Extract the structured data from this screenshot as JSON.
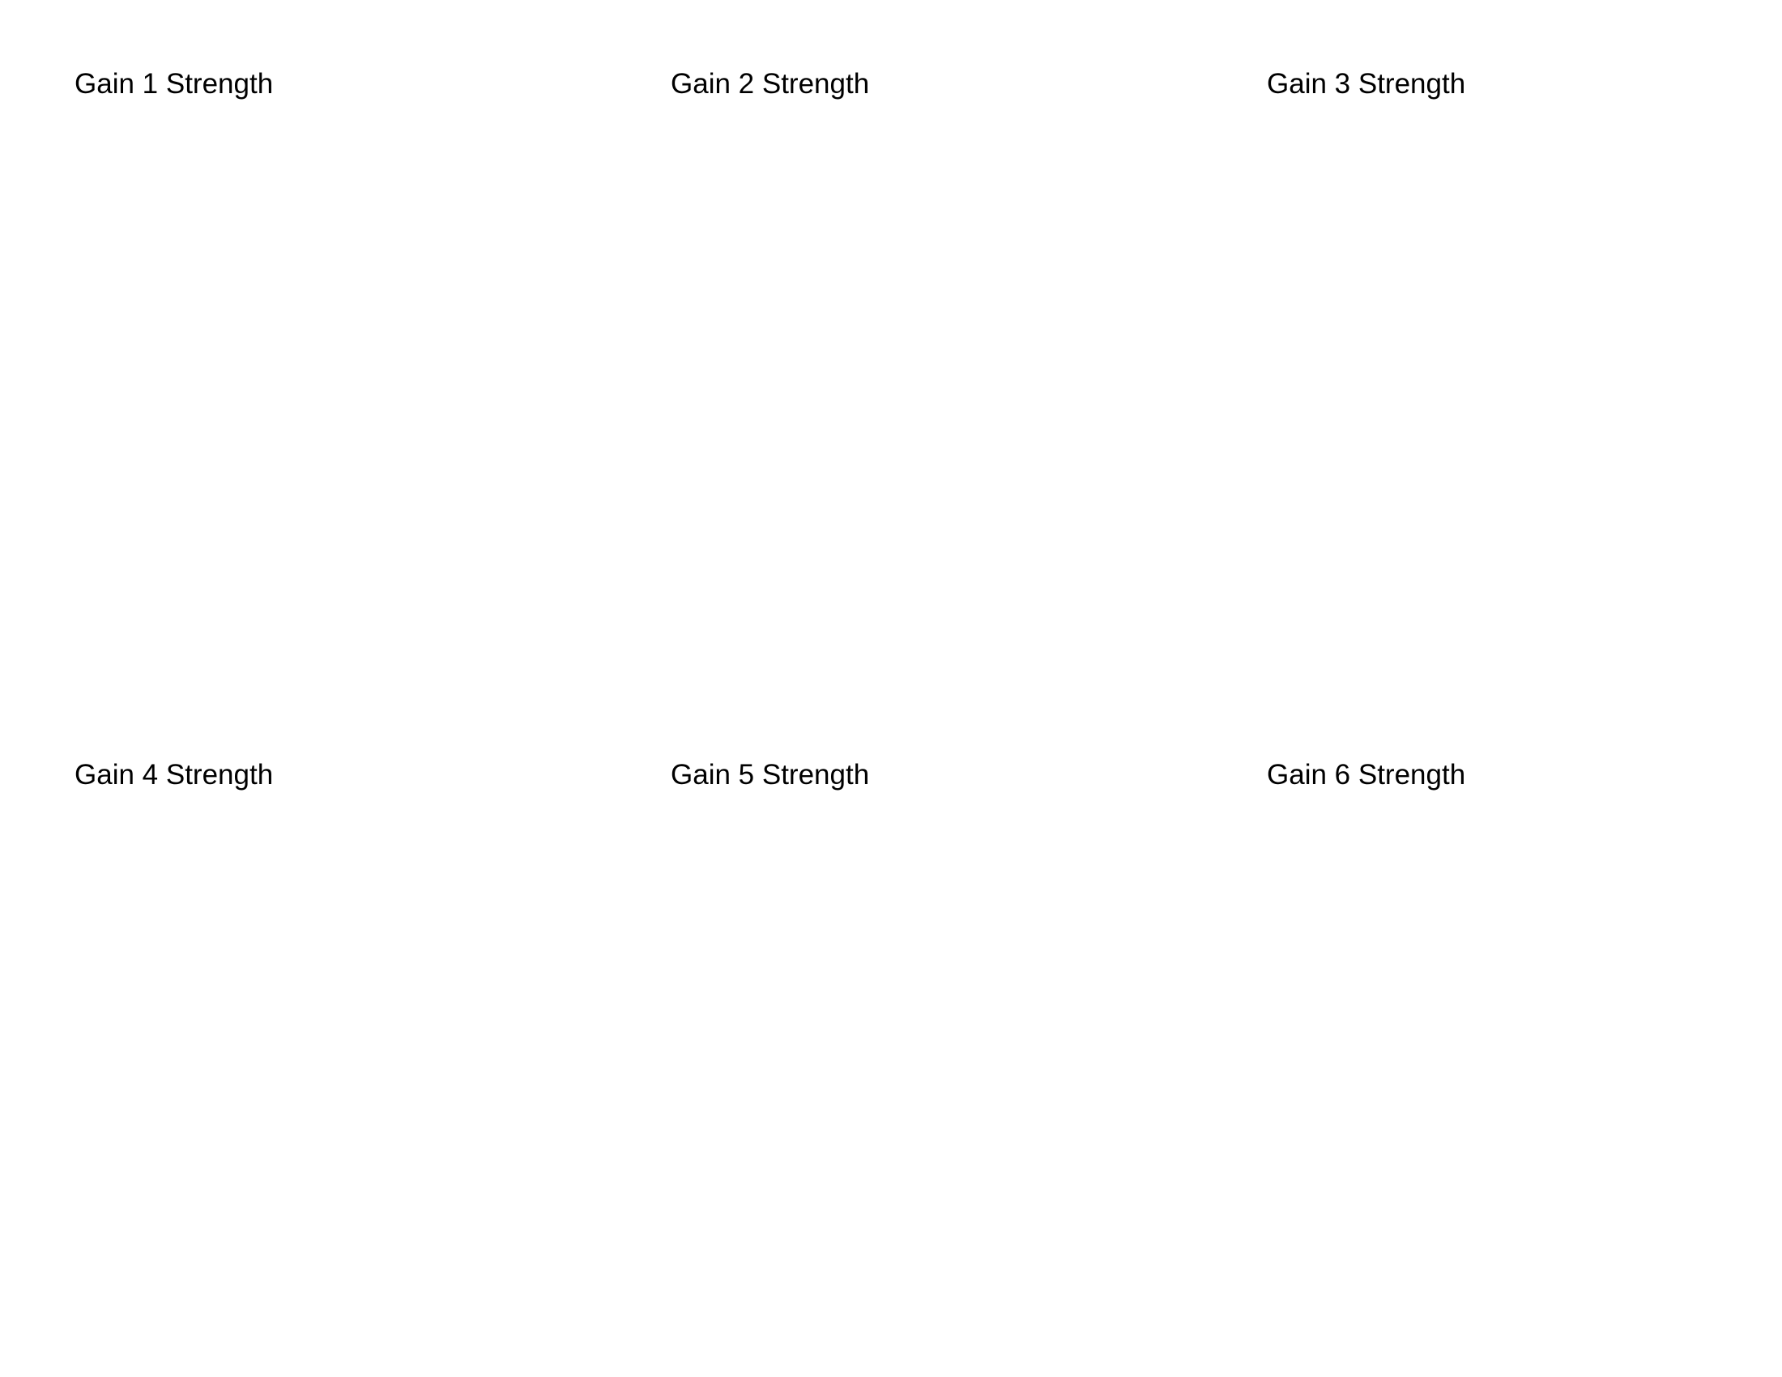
{
  "chart_data": [
    {
      "type": "bar",
      "title": "Gain 1 Strength",
      "categories": [],
      "values": []
    },
    {
      "type": "bar",
      "title": "Gain 2 Strength",
      "categories": [],
      "values": []
    },
    {
      "type": "bar",
      "title": "Gain 3 Strength",
      "categories": [],
      "values": []
    },
    {
      "type": "bar",
      "title": "Gain 4 Strength",
      "categories": [],
      "values": []
    },
    {
      "type": "bar",
      "title": "Gain 5 Strength",
      "categories": [],
      "values": []
    },
    {
      "type": "bar",
      "title": "Gain 6 Strength",
      "categories": [],
      "values": []
    }
  ]
}
